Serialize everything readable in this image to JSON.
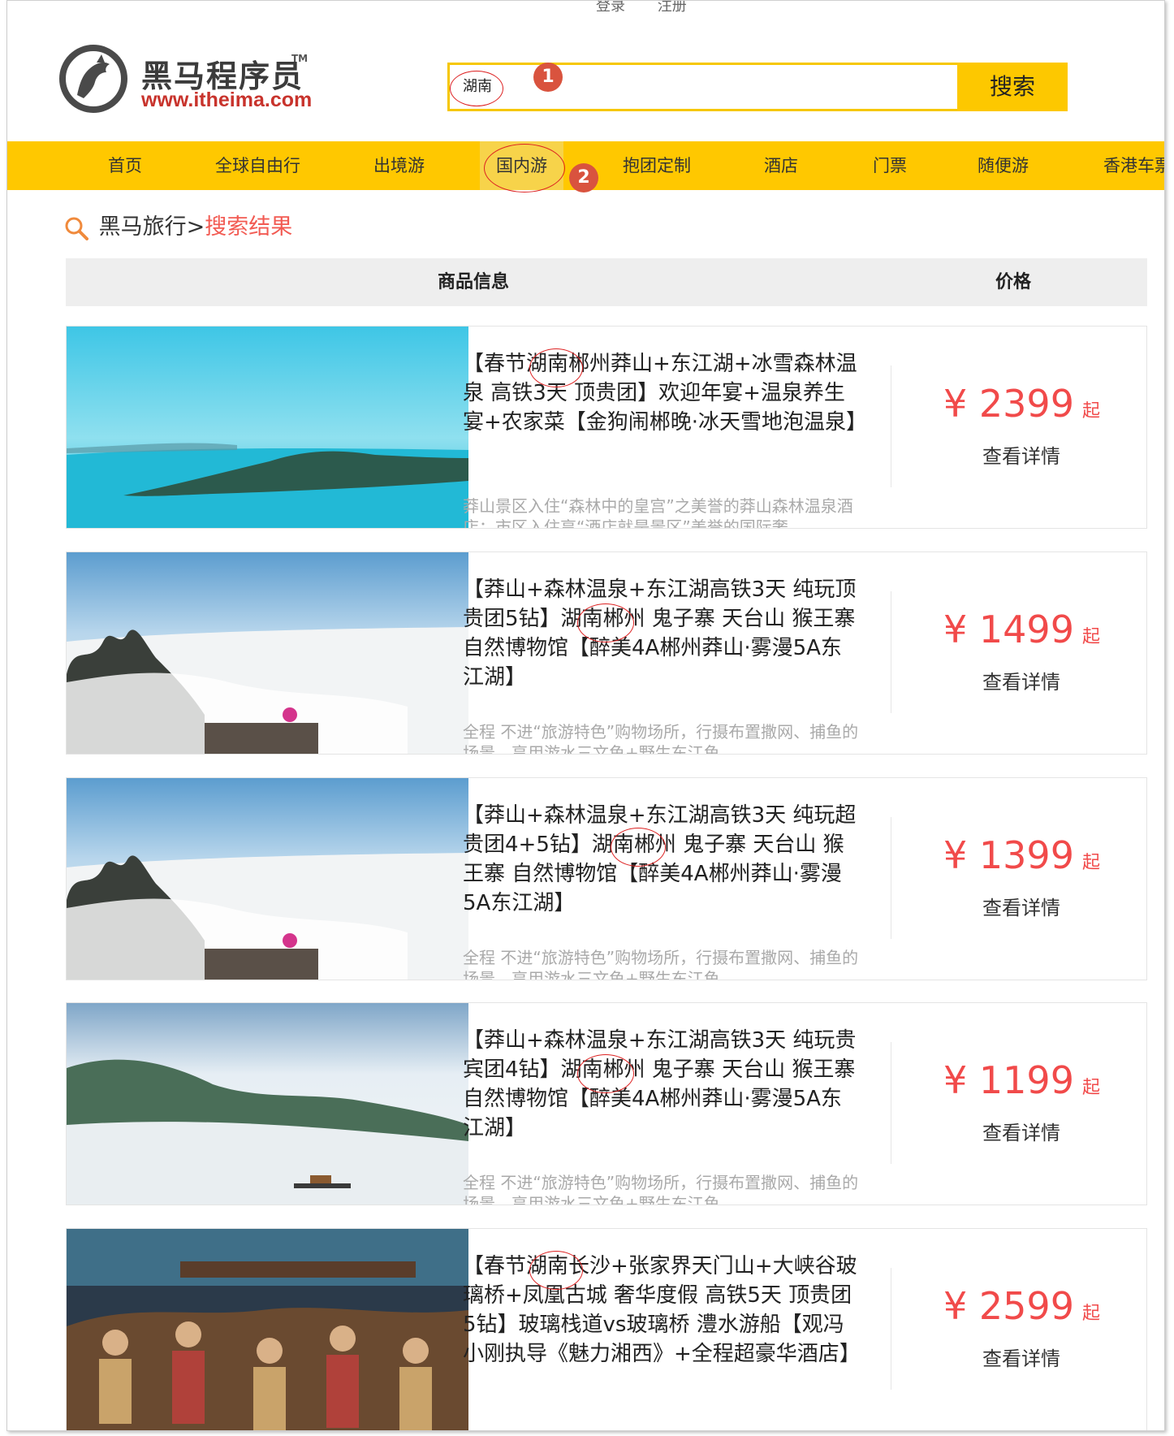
{
  "header": {
    "login_label": "登录",
    "register_label": "注册",
    "logo_name": "黑马程序员",
    "logo_tm": "TM",
    "logo_url": "www.itheima.com"
  },
  "search": {
    "value": "湖南",
    "button_label": "搜索"
  },
  "annotations": [
    "1",
    "2"
  ],
  "nav": {
    "items": [
      "首页",
      "全球自由行",
      "出境游",
      "国内游",
      "抱团定制",
      "酒店",
      "门票",
      "随便游",
      "香港车票"
    ],
    "active_index": 3
  },
  "breadcrumb": {
    "home": "黑马旅行>",
    "current": "搜索结果"
  },
  "table": {
    "col_info": "商品信息",
    "col_price": "价格"
  },
  "products": [
    {
      "title": "【春节湖南郴州莽山+东江湖+冰雪森林温泉 高铁3天 顶贵团】欢迎年宴+温泉养生宴+农家菜【金狗闹郴晚·冰天雪地泡温泉】",
      "desc": "莽山景区入住“森林中的皇宫”之美誉的莽山森林温泉酒店；市区入住享“酒店就是景区”美誉的国际奢",
      "price": "¥ 2399",
      "price_suffix": "起",
      "detail_label": "查看详情",
      "image": "lake-island-scene"
    },
    {
      "title": "【莽山+森林温泉+东江湖高铁3天 纯玩顶贵团5钻】湖南郴州 鬼子寨 天台山 猴王寨 自然博物馆【醉美4A郴州莽山·雾漫5A东江湖】",
      "desc": "全程 不进“旅游特色”购物场所，行摄布置撒网、捕鱼的场景，享用游水三文鱼+野生东江鱼",
      "price": "¥ 1499",
      "price_suffix": "起",
      "detail_label": "查看详情",
      "image": "sea-of-clouds-scene"
    },
    {
      "title": "【莽山+森林温泉+东江湖高铁3天 纯玩超贵团4+5钻】湖南郴州 鬼子寨 天台山 猴王寨 自然博物馆【醉美4A郴州莽山·雾漫5A东江湖】",
      "desc": "全程 不进“旅游特色”购物场所，行摄布置撒网、捕鱼的场景，享用游水三文鱼+野生东江鱼",
      "price": "¥ 1399",
      "price_suffix": "起",
      "detail_label": "查看详情",
      "image": "sea-of-clouds-scene"
    },
    {
      "title": "【莽山+森林温泉+东江湖高铁3天 纯玩贵宾团4钻】湖南郴州 鬼子寨 天台山 猴王寨 自然博物馆【醉美4A郴州莽山·雾漫5A东江湖】",
      "desc": "全程 不进“旅游特色”购物场所，行摄布置撒网、捕鱼的场景，享用游水三文鱼+野生东江鱼",
      "price": "¥ 1199",
      "price_suffix": "起",
      "detail_label": "查看详情",
      "image": "misty-lake-boat-scene"
    },
    {
      "title": "【春节湖南长沙+张家界天门山+大峡谷玻璃桥+凤凰古城 奢华度假 高铁5天 顶贵团5钻】玻璃栈道vs玻璃桥 澧水游船【观冯小刚执导《魅力湘西》+全程超豪华酒店】",
      "desc": "",
      "price": "¥ 2599",
      "price_suffix": "起",
      "detail_label": "查看详情",
      "image": "folk-dance-performance-scene"
    }
  ]
}
